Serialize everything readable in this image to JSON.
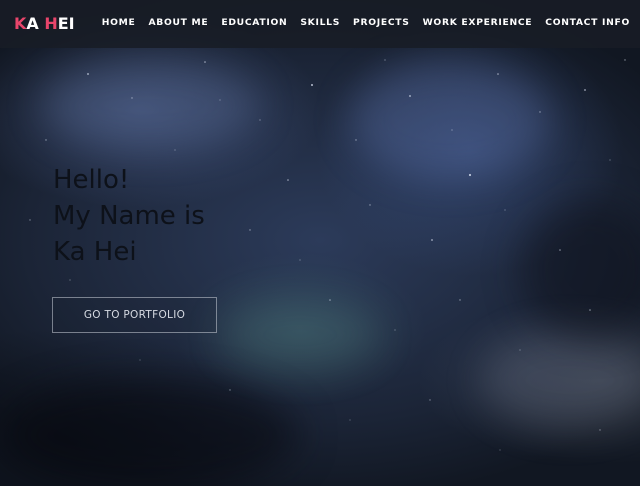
{
  "brand": {
    "first": "K",
    "first_rest": "A ",
    "second": "H",
    "second_rest": "EI",
    "accent_color": "#e8456b"
  },
  "nav": {
    "items": [
      {
        "label": "HOME"
      },
      {
        "label": "ABOUT ME"
      },
      {
        "label": "EDUCATION"
      },
      {
        "label": "SKILLS"
      },
      {
        "label": "PROJECTS"
      },
      {
        "label": "WORK EXPERIENCE"
      },
      {
        "label": "CONTACT INFO"
      }
    ]
  },
  "hero": {
    "lines": [
      "Hello!",
      "My Name is",
      "Ka Hei"
    ],
    "cta_label": "GO TO PORTFOLIO"
  }
}
